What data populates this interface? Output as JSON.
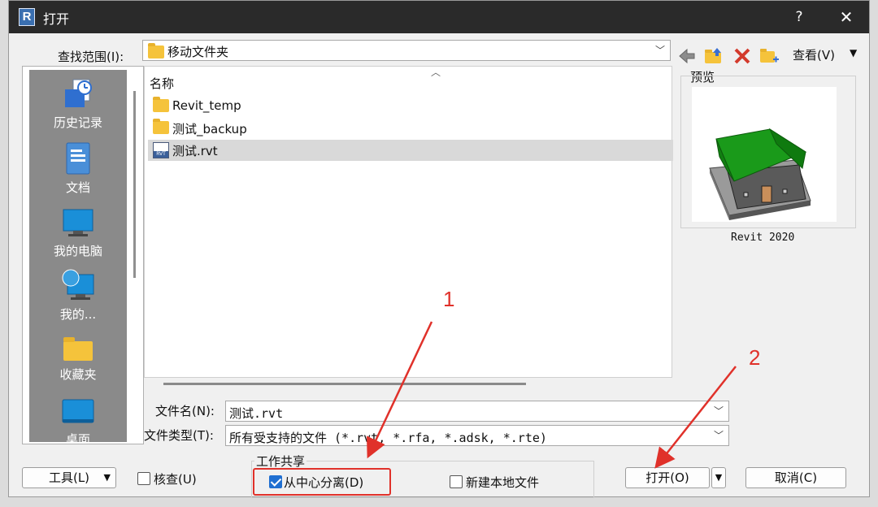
{
  "window": {
    "title": "打开",
    "help": "?",
    "close": "✕"
  },
  "lookin": {
    "label": "查找范围(I):",
    "value": "移动文件夹"
  },
  "toolbar": {
    "view_label": "查看(V)"
  },
  "places": [
    {
      "label": "历史记录",
      "icon": "history-icon"
    },
    {
      "label": "文档",
      "icon": "documents-icon"
    },
    {
      "label": "我的电脑",
      "icon": "computer-icon"
    },
    {
      "label": "我的...",
      "icon": "network-icon"
    },
    {
      "label": "收藏夹",
      "icon": "favorites-folder-icon"
    },
    {
      "label": "桌面",
      "icon": "desktop-icon"
    }
  ],
  "filelist": {
    "column_name": "名称",
    "files": [
      {
        "name": "Revit_temp",
        "type": "folder"
      },
      {
        "name": "测试_backup",
        "type": "folder"
      },
      {
        "name": "测试.rvt",
        "type": "rvt",
        "selected": true
      }
    ]
  },
  "preview": {
    "label": "预览",
    "caption": "Revit 2020"
  },
  "filename": {
    "label": "文件名(N):",
    "value": "测试.rvt"
  },
  "filetype": {
    "label": "文件类型(T):",
    "value": "所有受支持的文件 (*.rvt, *.rfa, *.adsk, *.rte)"
  },
  "bottom": {
    "tools_label": "工具(L)",
    "audit_label": "核查(U)",
    "audit_checked": false,
    "worksharing_title": "工作共享",
    "detach_label": "从中心分离(D)",
    "detach_checked": true,
    "new_local_label": "新建本地文件",
    "new_local_checked": false,
    "open_label": "打开(O)",
    "cancel_label": "取消(C)"
  },
  "annotations": {
    "step1": "1",
    "step2": "2",
    "color": "#e0312a"
  },
  "colors": {
    "titlebar": "#2a2a2a",
    "places_bg": "#8a8a8a",
    "checkbox_accent": "#1f6fd1"
  }
}
